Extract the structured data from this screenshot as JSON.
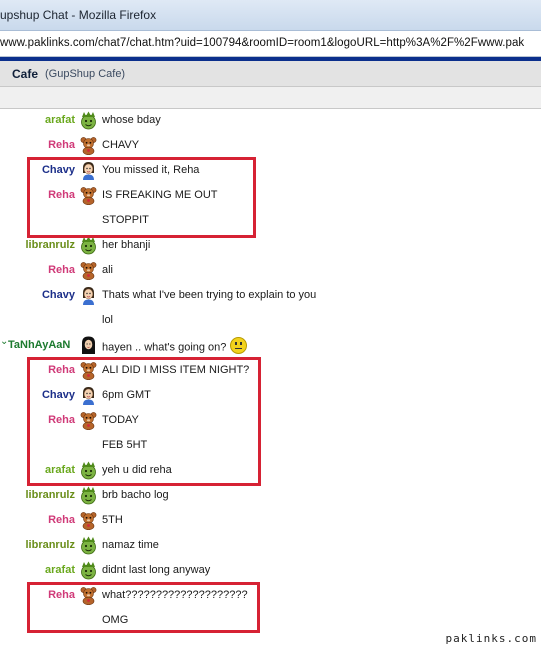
{
  "window": {
    "title": "upshup Chat - Mozilla Firefox"
  },
  "address": {
    "url": "www.paklinks.com/chat7/chat.htm?uid=100794&roomID=room1&logoURL=http%3A%2F%2Fwww.pak"
  },
  "room": {
    "name": "Cafe",
    "subtitle": "(GupShup Cafe)"
  },
  "colors": {
    "arafat": "#6aa81e",
    "Reha": "#d03a78",
    "Chavy": "#1c2f8a",
    "libranrulz": "#6a8e1a",
    "TaNhAyAaN": "#1c7a2e",
    "highlight": "#d62234"
  },
  "messages": [
    {
      "user": "arafat",
      "avatar": "green-face-icon",
      "text": "whose bday"
    },
    {
      "user": "Reha",
      "avatar": "teddy-bear-icon",
      "text": "CHAVY"
    },
    {
      "user": "Chavy",
      "avatar": "girl-avatar-icon",
      "text": "You missed it, Reha"
    },
    {
      "user": "Reha",
      "avatar": "teddy-bear-icon",
      "text": "IS FREAKING ME OUT"
    },
    {
      "user": "",
      "avatar": "",
      "text": "STOPPIT"
    },
    {
      "user": "libranrulz",
      "avatar": "green-face-icon",
      "text": "her bhanji"
    },
    {
      "user": "Reha",
      "avatar": "teddy-bear-icon",
      "text": "ali"
    },
    {
      "user": "Chavy",
      "avatar": "girl-avatar-icon",
      "text": "Thats what I've been trying to explain to you"
    },
    {
      "user": "",
      "avatar": "",
      "text": "lol"
    },
    {
      "user": "TaNhAyAaN",
      "avatar": "dark-hair-avatar-icon",
      "text": "hayen .. what's going on?"
    },
    {
      "user": "Reha",
      "avatar": "teddy-bear-icon",
      "text": "ALI DID I MISS ITEM NIGHT?"
    },
    {
      "user": "Chavy",
      "avatar": "girl-avatar-icon",
      "text": "6pm GMT"
    },
    {
      "user": "Reha",
      "avatar": "teddy-bear-icon",
      "text": "TODAY"
    },
    {
      "user": "",
      "avatar": "",
      "text": "FEB 5HT"
    },
    {
      "user": "arafat",
      "avatar": "green-face-icon",
      "text": "yeh u did reha"
    },
    {
      "user": "libranrulz",
      "avatar": "green-face-icon",
      "text": "brb bacho log"
    },
    {
      "user": "Reha",
      "avatar": "teddy-bear-icon",
      "text": "5TH"
    },
    {
      "user": "libranrulz",
      "avatar": "green-face-icon",
      "text": "namaz time"
    },
    {
      "user": "arafat",
      "avatar": "green-face-icon",
      "text": "didnt last long anyway"
    },
    {
      "user": "Reha",
      "avatar": "teddy-bear-icon",
      "text": "what????????????????????"
    },
    {
      "user": "",
      "avatar": "",
      "text": "OMG"
    }
  ],
  "watermark": "paklinks.com"
}
